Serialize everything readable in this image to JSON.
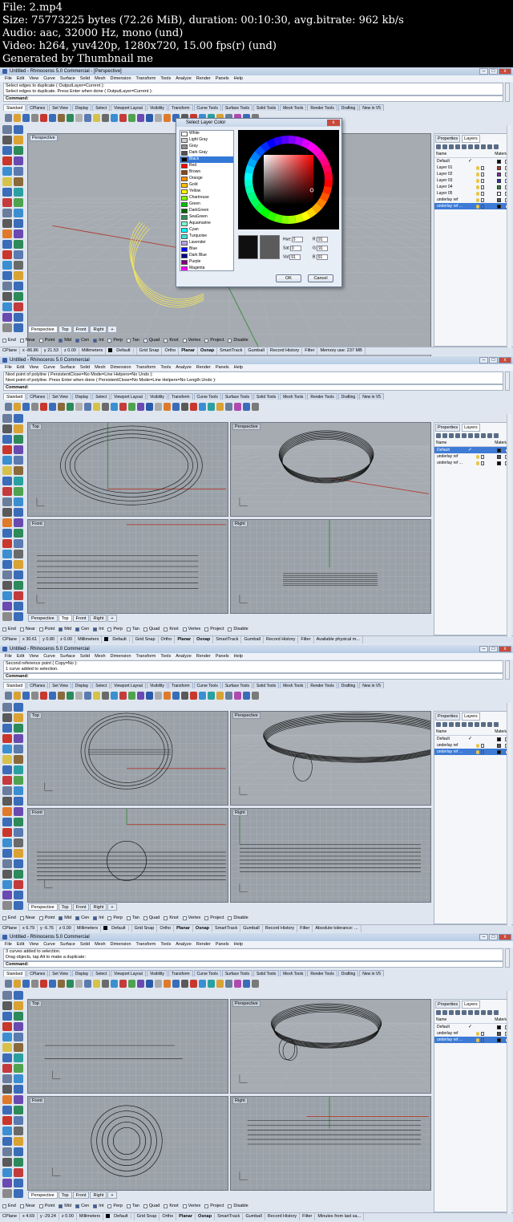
{
  "header": {
    "line1": "File: 2.mp4",
    "line2": "Size: 75773225 bytes (72.26 MiB), duration: 00:10:30, avg.bitrate: 962 kb/s",
    "line3": "Audio: aac, 32000 Hz, mono (und)",
    "line4": "Video: h264, yuv420p, 1280x720, 15.00 fps(r) (und)",
    "line5": "Generated by Thumbnail me"
  },
  "menu": [
    "File",
    "Edit",
    "View",
    "Curve",
    "Surface",
    "Solid",
    "Mesh",
    "Dimension",
    "Transform",
    "Tools",
    "Analyze",
    "Render",
    "Panels",
    "Help"
  ],
  "toolbar_tabs": [
    "Standard",
    "CPlanes",
    "Set View",
    "Display",
    "Select",
    "Viewport Layout",
    "Visibility",
    "Transform",
    "Curve Tools",
    "Surface Tools",
    "Solid Tools",
    "Mesh Tools",
    "Render Tools",
    "Drafting",
    "New in V5"
  ],
  "command_label": "Command:",
  "vp_tabs": [
    "Perspective",
    "Top",
    "Front",
    "Right"
  ],
  "vp_add": "+",
  "osnaps": [
    "End",
    "Near",
    "Point",
    "Mid",
    "Cen",
    "Int",
    "Perp",
    "Tan",
    "Quad",
    "Knot",
    "Vertex",
    "Project",
    "Disable"
  ],
  "status_common": {
    "cplane": "CPlane",
    "z": "z 0.00",
    "units": "Millimeters",
    "layer": "Default",
    "grid": "Grid Snap",
    "ortho": "Ortho",
    "planar": "Planar",
    "osnap": "Osnap",
    "smart": "SmartTrack",
    "gumball": "Gumball",
    "history": "Record History",
    "filter": "Filter"
  },
  "panel": {
    "tab_props": "Properties",
    "tab_layers": "Layers",
    "col_name": "Name",
    "col_material": "Material"
  },
  "colors": {
    "bg": "#dfe6ef",
    "viewport": "#9aa1a8",
    "grid": "#b6bcc2",
    "accent_blue": "#3d7bd6",
    "selected_curve": "#f5e65b",
    "axis_x": "#b03a2e",
    "axis_y": "#3a8b3a"
  },
  "frames": [
    {
      "title": "Untitled - Rhinoceros 5.0 Commercial - [Perspective]",
      "hist1": "Select edges to duplicate ( OutputLayer=Current ):",
      "hist2": "Select edges to duplicate. Press Enter when done ( OutputLayer=Current ):",
      "x": "x -86.86",
      "y": "y 21.53",
      "last": "Memory use: 237 MB",
      "viewport_labels": [
        "Perspective"
      ],
      "active_vp_tab": "Perspective",
      "layers": [
        {
          "name": "Default",
          "check": "✓",
          "color": "#000000",
          "sel": false
        },
        {
          "name": "Layer 01",
          "color": "#c03030",
          "sel": false
        },
        {
          "name": "Layer 02",
          "color": "#7a2ea8",
          "sel": false
        },
        {
          "name": "Layer 03",
          "color": "#2a36b0",
          "sel": false
        },
        {
          "name": "Layer 04",
          "color": "#2a8a2a",
          "sel": false
        },
        {
          "name": "Layer 05",
          "color": "#ffffff",
          "sel": false
        },
        {
          "name": "underlay ref",
          "color": "#555555",
          "sel": false
        },
        {
          "name": "underlay ref ...",
          "color": "#000000",
          "sel": true
        }
      ],
      "dialog": {
        "title": "Select Layer Color",
        "colors": [
          {
            "name": "White",
            "hex": "#ffffff"
          },
          {
            "name": "Light Gray",
            "hex": "#d0d0d0"
          },
          {
            "name": "Gray",
            "hex": "#909090"
          },
          {
            "name": "Dark Gray",
            "hex": "#505050"
          },
          {
            "name": "Black",
            "hex": "#000000",
            "sel": true
          },
          {
            "name": "Red",
            "hex": "#ff0000"
          },
          {
            "name": "Brown",
            "hex": "#8b4513"
          },
          {
            "name": "Orange",
            "hex": "#ff8c00"
          },
          {
            "name": "Gold",
            "hex": "#ffc000"
          },
          {
            "name": "Yellow",
            "hex": "#ffff00"
          },
          {
            "name": "Chartreuse",
            "hex": "#7fff00"
          },
          {
            "name": "Green",
            "hex": "#00c000"
          },
          {
            "name": "DarkGreen",
            "hex": "#006400"
          },
          {
            "name": "SeaGreen",
            "hex": "#2e8b57"
          },
          {
            "name": "Aquamarine",
            "hex": "#7fffd4"
          },
          {
            "name": "Cyan",
            "hex": "#00ffff"
          },
          {
            "name": "Turquoise",
            "hex": "#40e0d0"
          },
          {
            "name": "Lavender",
            "hex": "#b8a0e8"
          },
          {
            "name": "Blue",
            "hex": "#0000ff"
          },
          {
            "name": "Dark Blue",
            "hex": "#00008b"
          },
          {
            "name": "Purple",
            "hex": "#800080"
          },
          {
            "name": "Magenta",
            "hex": "#ff00ff"
          }
        ],
        "hue_label": "Hue:",
        "hue": "0",
        "sat_label": "Sat:",
        "sat": "0",
        "val_label": "Val:",
        "val": "91",
        "r_label": "R:",
        "r": "91",
        "g_label": "G:",
        "g": "91",
        "b_label": "B:",
        "b": "91",
        "ok": "OK",
        "cancel": "Cancel"
      }
    },
    {
      "title": "Untitled - Rhinoceros 5.0 Commercial",
      "hist1": "Next point of polyline ( PersistentClose=No  Mode=Line  Helpers=No  Undo ):",
      "hist2": "Next point of polyline. Press Enter when done ( PersistentClose=No  Mode=Line  Helpers=No  Length  Undo ):",
      "x": "x 30.61",
      "y": "y 0.80",
      "last": "Available physical m...",
      "viewport_labels": [
        "Top",
        "Perspective",
        "Front",
        "Right"
      ],
      "active_vp_tab": "Top",
      "layers": [
        {
          "name": "Default",
          "check": "✓",
          "color": "#000000",
          "sel": true
        },
        {
          "name": "underlay ref",
          "color": "#555555",
          "sel": false
        },
        {
          "name": "underlay ref ...",
          "color": "#000000",
          "sel": false
        }
      ]
    },
    {
      "title": "Untitled - Rhinoceros 5.0 Commercial",
      "hist1": "Second reference point ( Copy=No ):",
      "hist2": "1 curve added to selection.",
      "x": "x 6.79",
      "y": "y -6.76",
      "last": "Absolute tolerance: ...",
      "viewport_labels": [
        "Top",
        "Perspective",
        "Front",
        "Right"
      ],
      "active_vp_tab": "Perspective",
      "layers": [
        {
          "name": "Default",
          "check": "✓",
          "color": "#000000",
          "sel": false
        },
        {
          "name": "underlay ref",
          "color": "#555555",
          "sel": false
        },
        {
          "name": "underlay ref ...",
          "color": "#000000",
          "sel": true
        }
      ]
    },
    {
      "title": "Untitled - Rhinoceros 5.0 Commercial",
      "hist1": "3 curves added to selection.",
      "hist2": "Drag objects, tap Alt to make a duplicate:",
      "x": "x 4.69",
      "y": "y -29.24",
      "last": "Minutes from last sa...",
      "viewport_labels": [
        "Top",
        "Perspective",
        "Front",
        "Right"
      ],
      "active_vp_tab": "Perspective",
      "layers": [
        {
          "name": "Default",
          "check": "✓",
          "color": "#000000",
          "sel": false
        },
        {
          "name": "underlay ref",
          "color": "#555555",
          "sel": false
        },
        {
          "name": "underlay ref ...",
          "color": "#000000",
          "sel": true
        }
      ]
    }
  ]
}
